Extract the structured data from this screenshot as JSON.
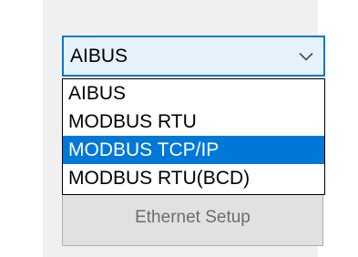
{
  "protocol_select": {
    "value": "AIBUS",
    "options": [
      "AIBUS",
      "MODBUS RTU",
      "MODBUS TCP/IP",
      "MODBUS RTU(BCD)"
    ],
    "highlighted_option": "MODBUS TCP/IP"
  },
  "ethernet_button": {
    "label": "Ethernet Setup"
  },
  "icons": {
    "dropdown_arrow": "chevron-down-icon"
  },
  "colors": {
    "accent": "#0078d7",
    "select_background": "#e5f1fb",
    "panel_background": "#f0f0f0",
    "button_background": "#e1e1e1",
    "disabled_text": "#6d6d6d"
  }
}
